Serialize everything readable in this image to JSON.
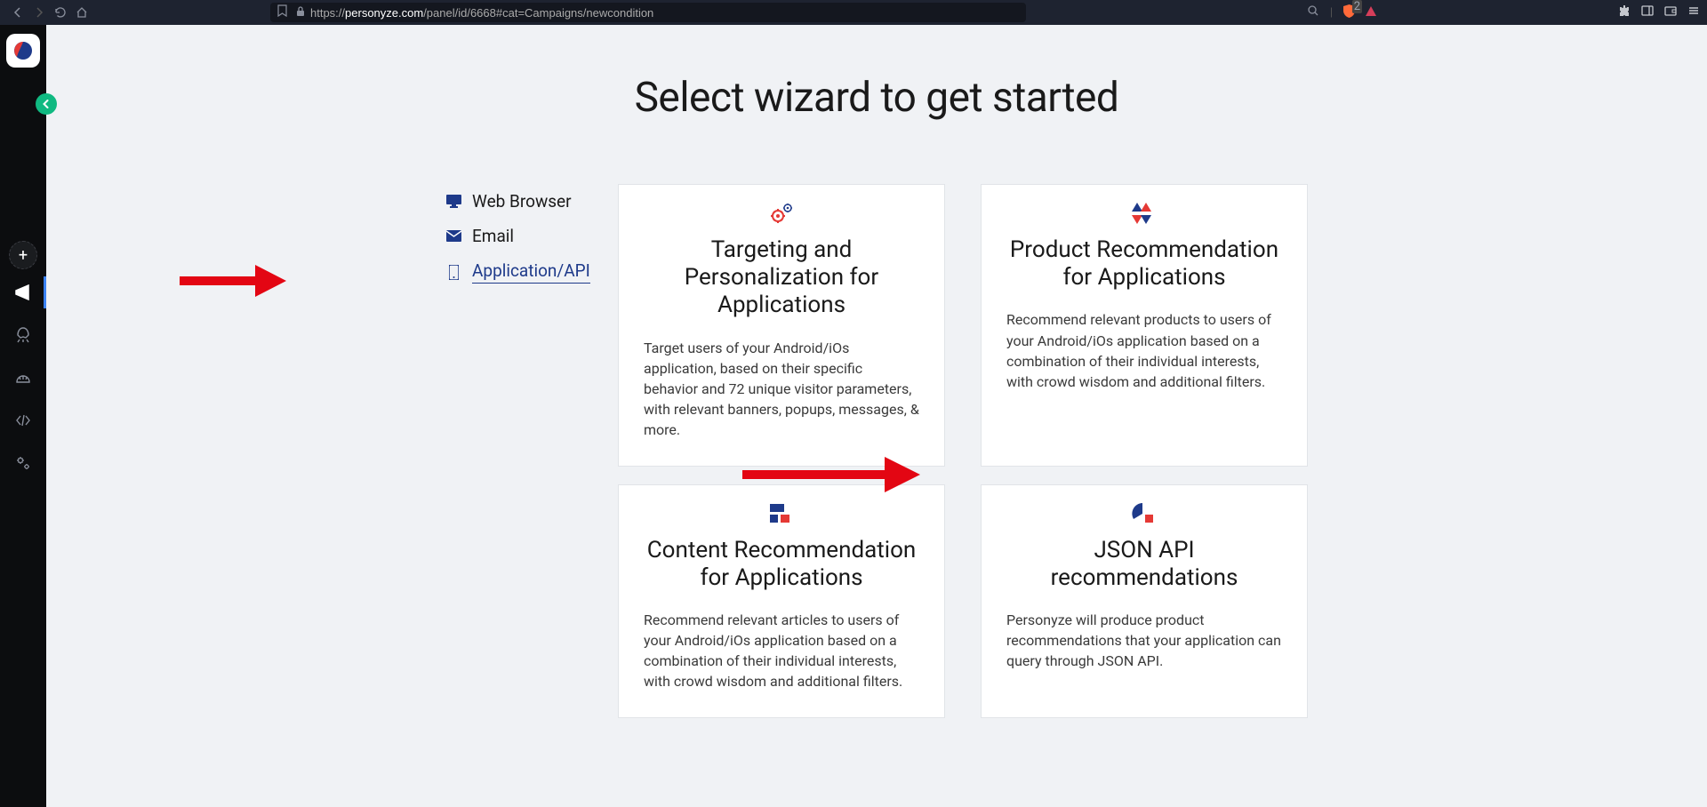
{
  "browser": {
    "url_prefix": "https://",
    "url_domain": "personyze.com",
    "url_path": "/panel/id/6668#cat=Campaigns/newcondition",
    "shield_count": "2"
  },
  "page": {
    "title": "Select wizard to get started"
  },
  "tabs": [
    {
      "label": "Web Browser",
      "active": false
    },
    {
      "label": "Email",
      "active": false
    },
    {
      "label": "Application/API",
      "active": true
    }
  ],
  "cards": [
    {
      "title": "Targeting and Personalization for Applications",
      "desc": "Target users of your Android/iOs application, based on their specific behavior and 72 unique visitor parameters, with relevant banners, popups, messages, & more."
    },
    {
      "title": "Product Recommendation for Applications",
      "desc": "Recommend relevant products to users of your Android/iOs application based on a combination of their individual interests, with crowd wisdom and additional filters."
    },
    {
      "title": "Content Recommendation for Applications",
      "desc": "Recommend relevant articles to users of your Android/iOs application based on a combination of their individual interests, with crowd wisdom and additional filters."
    },
    {
      "title": "JSON API recommendations",
      "desc": "Personyze will produce product recommendations that your application can query through JSON API."
    }
  ]
}
